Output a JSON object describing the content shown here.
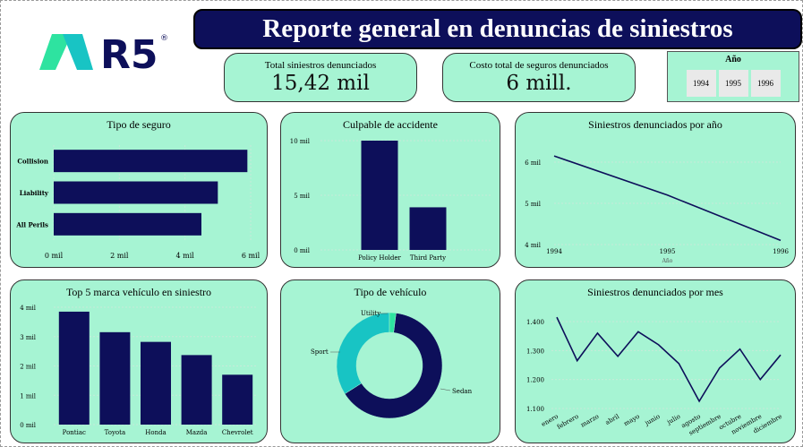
{
  "header": {
    "title": "Reporte general en denuncias de siniestros",
    "logo_text": "R5",
    "logo_mark": "®"
  },
  "kpis": [
    {
      "label": "Total siniestros denunciados",
      "value": "15,42 mil"
    },
    {
      "label": "Costo total de seguros denunciados",
      "value": "6 mill."
    }
  ],
  "slicer": {
    "label": "Año",
    "options": [
      "1994",
      "1995",
      "1996"
    ]
  },
  "colors": {
    "navy": "#0d0f5a",
    "mint": "#a6f4d3",
    "teal": "#18c4c4",
    "aqua": "#2ee3a0"
  },
  "chart_data": [
    {
      "id": "tipo-seguro",
      "type": "bar",
      "orientation": "horizontal",
      "title": "Tipo de seguro",
      "categories": [
        "Collision",
        "Liability",
        "All Perils"
      ],
      "values": [
        5900,
        5000,
        4500
      ],
      "xlim": [
        0,
        6000
      ],
      "ticks": [
        "0 mil",
        "2 mil",
        "4 mil",
        "6 mil"
      ]
    },
    {
      "id": "culpable",
      "type": "bar",
      "title": "Culpable de accidente",
      "categories": [
        "Policy Holder",
        "Third Party"
      ],
      "values": [
        11500,
        3900
      ],
      "ylim": [
        0,
        10000
      ],
      "ticks": [
        "0 mil",
        "5 mil",
        "10 mil"
      ]
    },
    {
      "id": "por-anio",
      "type": "line",
      "title": "Siniestros denunciados por año",
      "x": [
        "1994",
        "1995",
        "1996"
      ],
      "values": [
        6150,
        5200,
        4100
      ],
      "ylim": [
        4000,
        6000
      ],
      "ticks": [
        "4 mil",
        "5 mil",
        "6 mil"
      ],
      "xlabel": "Año"
    },
    {
      "id": "marcas",
      "type": "bar",
      "title": "Top 5 marca vehículo en siniestro",
      "categories": [
        "Pontiac",
        "Toyota",
        "Honda",
        "Mazda",
        "Chevrolet"
      ],
      "values": [
        3850,
        3150,
        2820,
        2370,
        1700
      ],
      "ylim": [
        0,
        4000
      ],
      "ticks": [
        "0 mil",
        "1 mil",
        "2 mil",
        "3 mil",
        "4 mil"
      ]
    },
    {
      "id": "tipo-vehiculo",
      "type": "pie",
      "title": "Tipo de vehículo",
      "categories": [
        "Sedan",
        "Sport",
        "Utility"
      ],
      "values": [
        64,
        34,
        2
      ]
    },
    {
      "id": "por-mes",
      "type": "line",
      "title": "Siniestros denunciados por mes",
      "x": [
        "enero",
        "febrero",
        "marzo",
        "abril",
        "mayo",
        "junio",
        "julio",
        "agosto",
        "septiembre",
        "octubre",
        "noviembre",
        "diciembre"
      ],
      "values": [
        1415,
        1265,
        1360,
        1280,
        1365,
        1320,
        1255,
        1125,
        1240,
        1305,
        1200,
        1285
      ],
      "ylim": [
        1100,
        1400
      ],
      "ticks": [
        "1.100",
        "1.200",
        "1.300",
        "1.400"
      ]
    }
  ]
}
